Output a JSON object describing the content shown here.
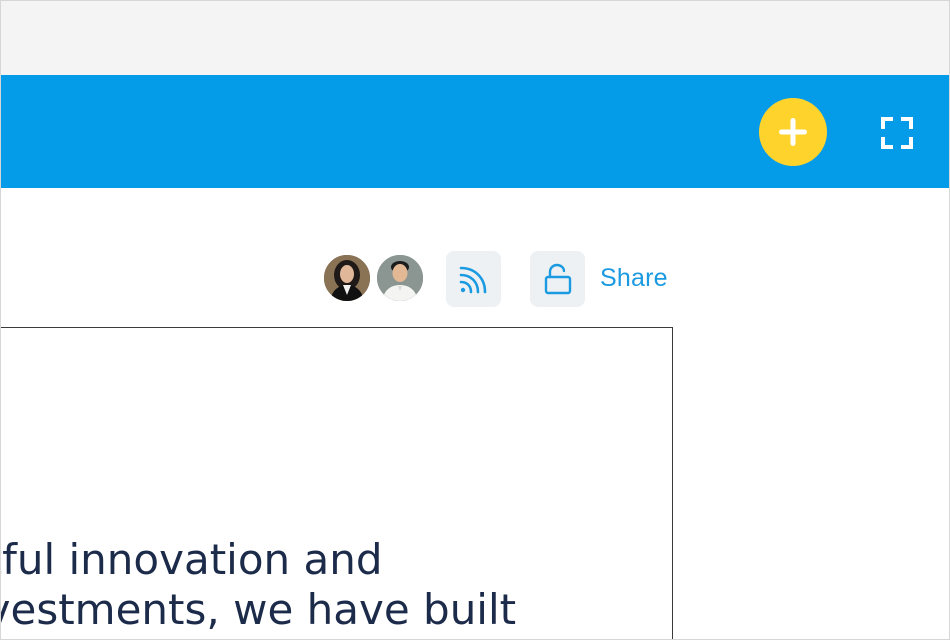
{
  "app_bar": {
    "add_icon": "plus-icon",
    "fullscreen_icon": "fullscreen-icon",
    "accent_color": "#049ce8",
    "add_button_color": "#fed32c"
  },
  "toolbar": {
    "avatars": [
      {
        "icon": "avatar-woman"
      },
      {
        "icon": "avatar-man"
      }
    ],
    "rss_icon": "rss-icon",
    "lock_icon": "unlock-icon",
    "share_label": "Share"
  },
  "document": {
    "lines": [
      "htful innovation and",
      "nvestments, we have built"
    ]
  }
}
